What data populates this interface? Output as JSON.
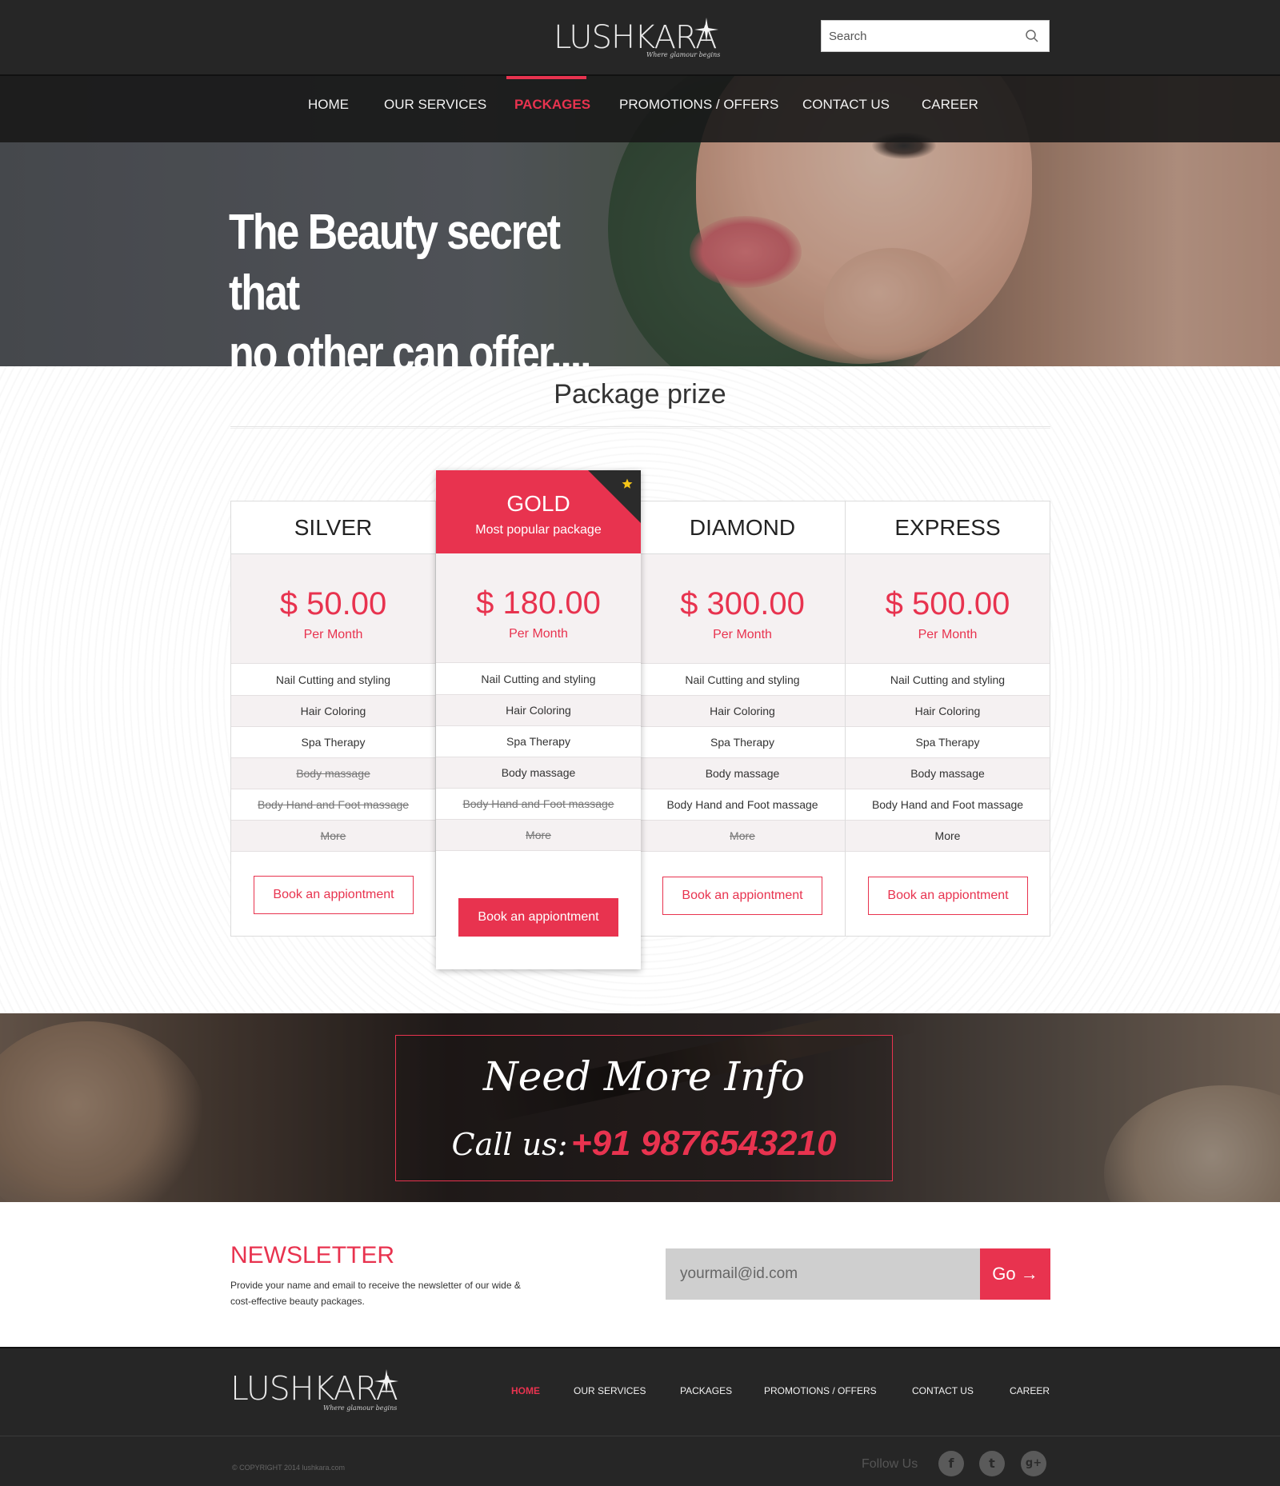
{
  "header": {
    "logo": {
      "name": "LUSHKARA",
      "tagline": "Where glamour begins"
    },
    "search": {
      "placeholder": "Search"
    }
  },
  "nav": {
    "items": [
      {
        "label": "HOME"
      },
      {
        "label": "OUR SERVICES"
      },
      {
        "label": "PACKAGES"
      },
      {
        "label": "PROMOTIONS / OFFERS"
      },
      {
        "label": "CONTACT US"
      },
      {
        "label": "CAREER"
      }
    ],
    "active": "PACKAGES"
  },
  "hero": {
    "line1": "The Beauty secret that",
    "line2": "no other can offer...."
  },
  "packages": {
    "title": "Package prize",
    "plans": [
      {
        "name": "SILVER",
        "price": "$ 50.00",
        "period": "Per Month",
        "features": [
          {
            "label": "Nail Cutting and styling",
            "included": true
          },
          {
            "label": "Hair Coloring",
            "included": true
          },
          {
            "label": "Spa Therapy",
            "included": true
          },
          {
            "label": "Body massage",
            "included": false
          },
          {
            "label": "Body Hand and Foot massage",
            "included": false
          },
          {
            "label": "More",
            "included": false
          }
        ],
        "cta": "Book an appiontment"
      },
      {
        "name": "GOLD",
        "subtitle": "Most popular package",
        "featured": true,
        "badge_icon": "star-icon",
        "price": "$ 180.00",
        "period": "Per Month",
        "features": [
          {
            "label": "Nail Cutting and styling",
            "included": true
          },
          {
            "label": "Hair Coloring",
            "included": true
          },
          {
            "label": "Spa Therapy",
            "included": true
          },
          {
            "label": "Body massage",
            "included": true
          },
          {
            "label": "Body Hand and Foot massage",
            "included": false
          },
          {
            "label": "More",
            "included": false
          }
        ],
        "cta": "Book an appiontment"
      },
      {
        "name": "DIAMOND",
        "price": "$ 300.00",
        "period": "Per Month",
        "features": [
          {
            "label": "Nail Cutting and styling",
            "included": true
          },
          {
            "label": "Hair Coloring",
            "included": true
          },
          {
            "label": "Spa Therapy",
            "included": true
          },
          {
            "label": "Body massage",
            "included": true
          },
          {
            "label": "Body Hand and Foot massage",
            "included": true
          },
          {
            "label": "More",
            "included": false
          }
        ],
        "cta": "Book an appiontment"
      },
      {
        "name": "EXPRESS",
        "price": "$ 500.00",
        "period": "Per Month",
        "features": [
          {
            "label": "Nail Cutting and styling",
            "included": true
          },
          {
            "label": "Hair Coloring",
            "included": true
          },
          {
            "label": "Spa Therapy",
            "included": true
          },
          {
            "label": "Body massage",
            "included": true
          },
          {
            "label": "Body Hand and Foot massage",
            "included": true
          },
          {
            "label": "More",
            "included": true
          }
        ],
        "cta": "Book an appiontment"
      }
    ]
  },
  "callout": {
    "title": "Need More Info",
    "call_label": "Call us:",
    "phone": "+91 9876543210"
  },
  "newsletter": {
    "title": "NEWSLETTER",
    "text": "Provide your name and email to receive the newsletter of our wide & cost-effective beauty packages.",
    "placeholder": "yourmail@id.com",
    "button": "Go →"
  },
  "footer": {
    "logo": {
      "name": "LUSHKARA",
      "tagline": "Where glamour begins"
    },
    "nav": [
      "HOME",
      "OUR SERVICES",
      "PACKAGES",
      "PROMOTIONS / OFFERS",
      "CONTACT US",
      "CAREER"
    ],
    "active": "HOME",
    "copyright": "© COPYRIGHT 2014  lushkara.com",
    "follow_label": "Follow Us",
    "social": [
      "facebook-icon",
      "twitter-icon",
      "google-plus-icon"
    ]
  },
  "colors": {
    "accent": "#e8334f",
    "header_bg": "#262626",
    "price_band": "#f5f1f2"
  }
}
